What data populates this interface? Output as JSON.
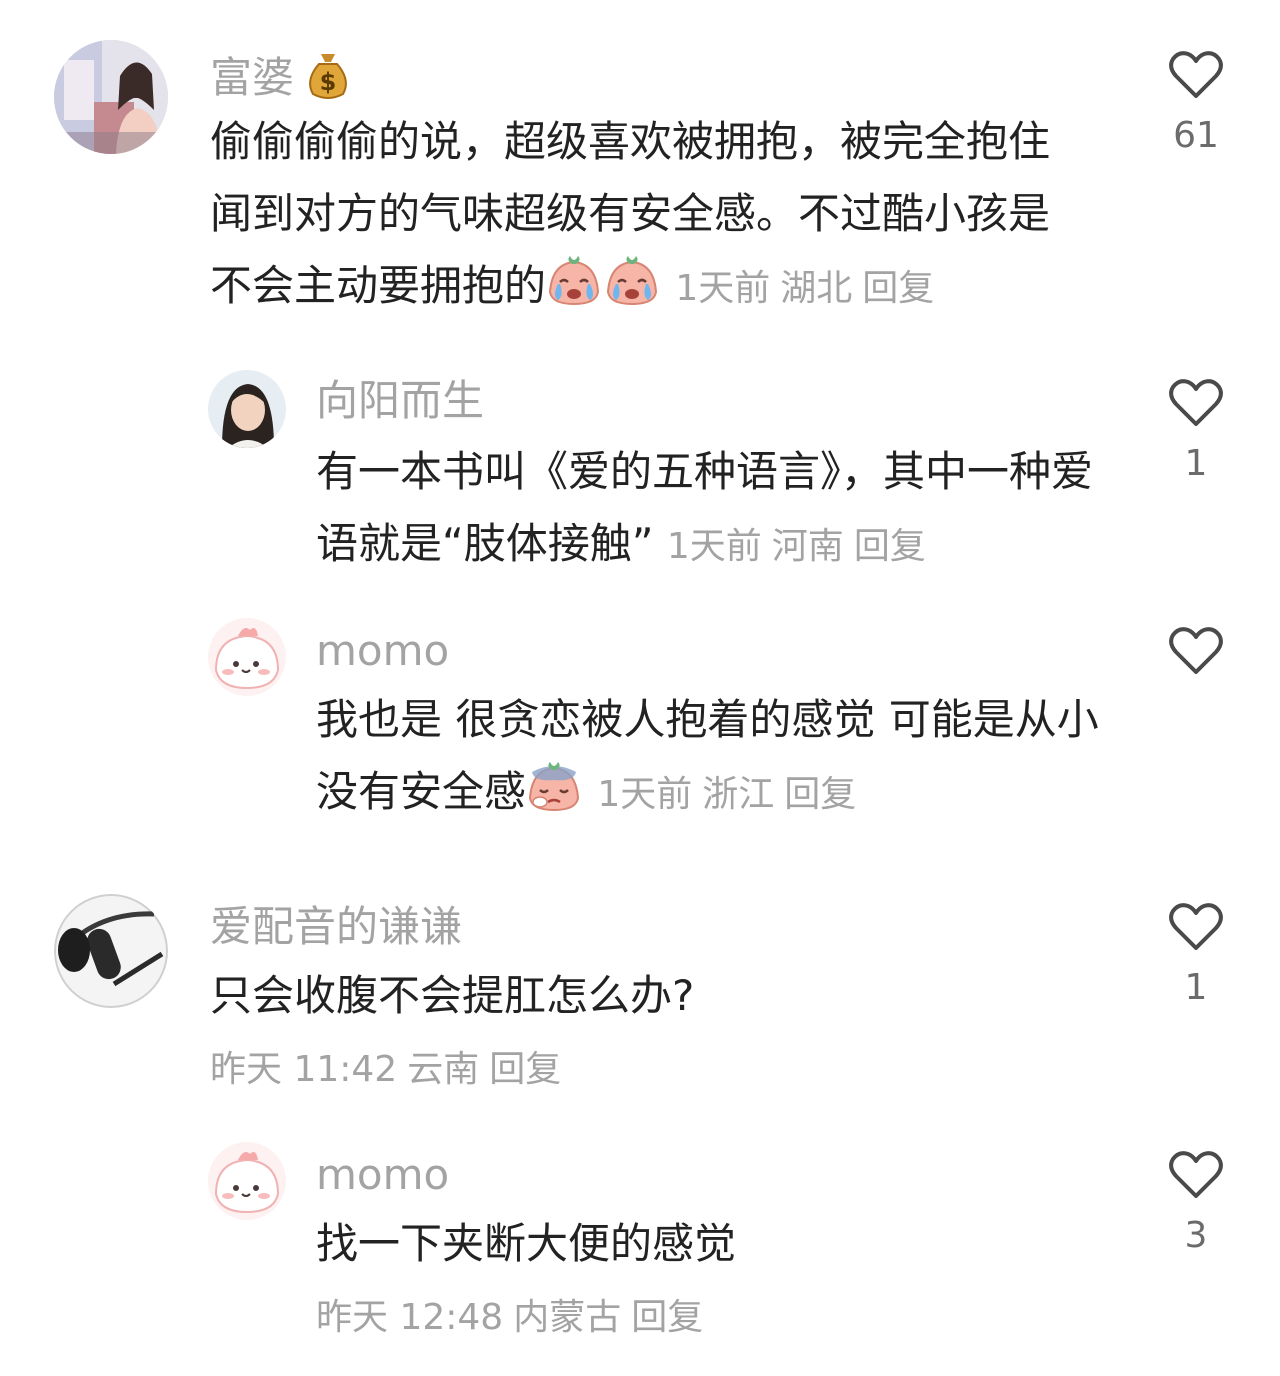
{
  "comments": [
    {
      "user": "富婆",
      "text": "偷偷偷偷的说，超级喜欢被拥抱，被完全抱住闻到对方的气味超级有安全感。不过酷小孩是不会主动要拥抱的",
      "time": "1天前",
      "location": "湖北",
      "reply": "回复",
      "likes": "61",
      "name_emoji": "money-bag-icon",
      "text_emojis": [
        "crying-peach-icon",
        "crying-peach-icon"
      ]
    },
    {
      "user": "向阳而生",
      "text": "有一本书叫《爱的五种语言》，其中一种爱语就是“肢体接触”",
      "time": "1天前",
      "location": "河南",
      "reply": "回复",
      "likes": "1"
    },
    {
      "user": "momo",
      "text": "我也是 很贪恋被人抱着的感觉 可能是从小没有安全感",
      "time": "1天前",
      "location": "浙江",
      "reply": "回复",
      "likes": "",
      "text_emojis": [
        "sad-peach-icon"
      ]
    },
    {
      "user": "爱配音的谦谦",
      "text": "只会收腹不会提肛怎么办?",
      "time": "昨天 11:42",
      "location": "云南",
      "reply": "回复",
      "likes": "1"
    },
    {
      "user": "momo",
      "text": "找一下夹断大便的感觉",
      "time": "昨天 12:48",
      "location": "内蒙古",
      "reply": "回复",
      "likes": "3"
    }
  ],
  "colors": {
    "secondary_text": "#a3a3a3",
    "primary_text": "#222222",
    "heart_outline": "#4a4a4a"
  }
}
